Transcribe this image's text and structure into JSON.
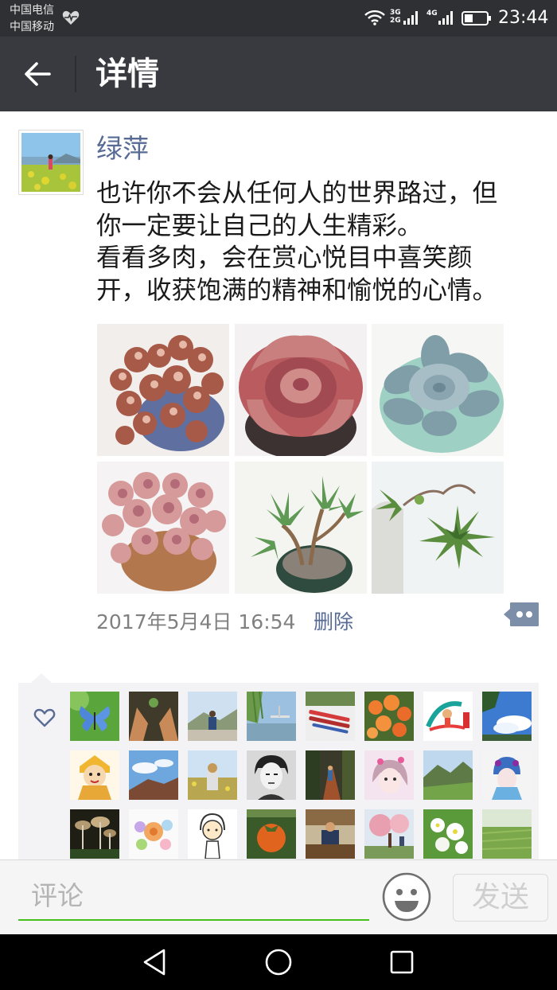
{
  "status_bar": {
    "carrier_1": "中国电信",
    "carrier_2": "中国移动",
    "network_labels": [
      "3G",
      "2G",
      "4G"
    ],
    "time": "23:44",
    "icons": [
      "heart-monitor-icon",
      "wifi-icon",
      "signal-bars-icon",
      "battery-icon"
    ]
  },
  "header": {
    "back_icon": "arrow-left-icon",
    "title": "详情"
  },
  "post": {
    "author": "绿萍",
    "text": "也许你不会从任何人的世界路过，但\n你一定要让自己的人生精彩。\n看看多肉，会在赏心悦目中喜笑颜\n开，收获饱满的精神和愉悦的心情。",
    "photos": [
      "succulent-photo-1",
      "succulent-photo-2",
      "succulent-photo-3",
      "succulent-photo-4",
      "succulent-photo-5",
      "succulent-photo-6"
    ],
    "time": "2017年5月4日  16:54",
    "delete_label": "删除",
    "comment_icon": "more-dots-icon"
  },
  "likes": {
    "icon": "heart-outline-icon",
    "avatars": [
      "butterfly",
      "hands",
      "hill-person",
      "willow-lake",
      "pens",
      "flowers",
      "cartoon-runner",
      "blue-sky",
      "cartoon-monk",
      "sky-hill",
      "field-person",
      "portrait-bw",
      "path-person",
      "girl-cartoon",
      "green-mountain",
      "opera-mask",
      "mushrooms",
      "flower-bouquet",
      "cartoon-girl",
      "persimmon",
      "office-person",
      "blossom-tree",
      "white-flowers",
      "green-field"
    ]
  },
  "comment_bar": {
    "placeholder": "评论",
    "emoji_icon": "smiley-icon",
    "send_label": "发送"
  },
  "nav_bar": {
    "icons": [
      "back-triangle-icon",
      "home-circle-icon",
      "recents-square-icon"
    ]
  },
  "colors": {
    "status_bar": "#2f3033",
    "title_bar": "#393a3f",
    "link": "#576b95",
    "accent_green": "#45c01a"
  }
}
